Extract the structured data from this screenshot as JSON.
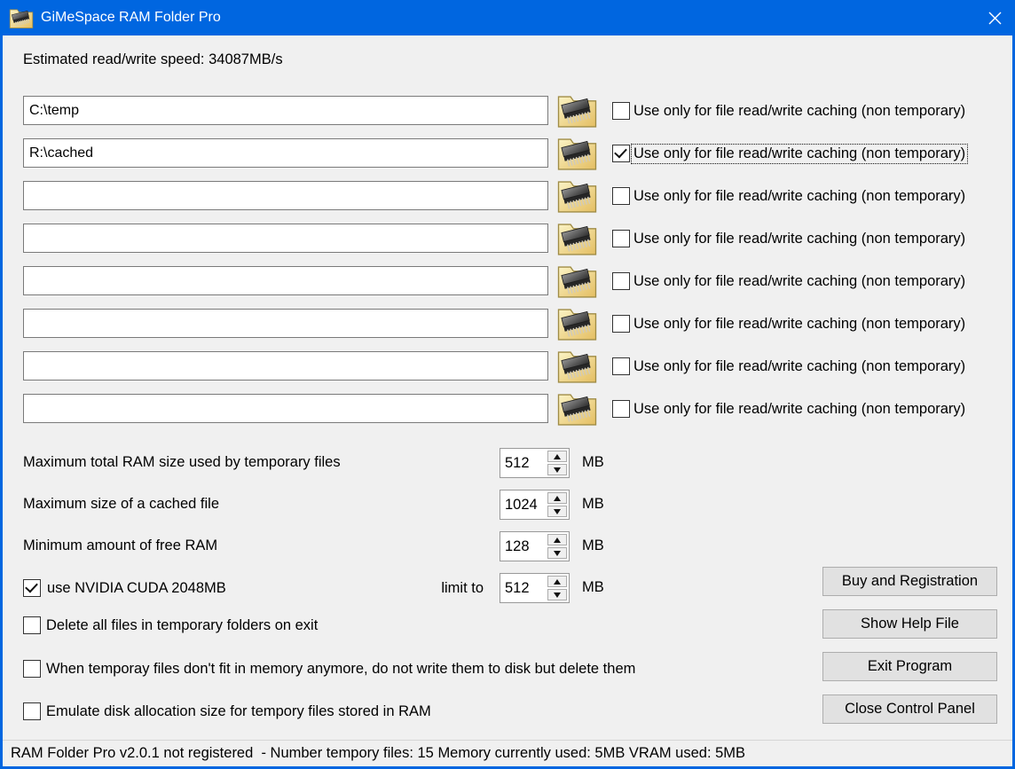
{
  "window": {
    "title": "GiMeSpace RAM Folder Pro"
  },
  "header": {
    "speed_text": "Estimated read/write speed: 34087MB/s"
  },
  "folders": {
    "rows": [
      {
        "path": "C:\\temp",
        "cache_only": false,
        "focused": false,
        "cache_label": "Use only for file read/write caching (non temporary)"
      },
      {
        "path": "R:\\cached",
        "cache_only": true,
        "focused": true,
        "cache_label": "Use only for file read/write caching (non temporary)"
      },
      {
        "path": "",
        "cache_only": false,
        "focused": false,
        "cache_label": "Use only for file read/write caching (non temporary)"
      },
      {
        "path": "",
        "cache_only": false,
        "focused": false,
        "cache_label": "Use only for file read/write caching (non temporary)"
      },
      {
        "path": "",
        "cache_only": false,
        "focused": false,
        "cache_label": "Use only for file read/write caching (non temporary)"
      },
      {
        "path": "",
        "cache_only": false,
        "focused": false,
        "cache_label": "Use only for file read/write caching (non temporary)"
      },
      {
        "path": "",
        "cache_only": false,
        "focused": false,
        "cache_label": "Use only for file read/write caching (non temporary)"
      },
      {
        "path": "",
        "cache_only": false,
        "focused": false,
        "cache_label": "Use only for file read/write caching (non temporary)"
      }
    ]
  },
  "settings": {
    "rows": [
      {
        "label": "Maximum total RAM size used by temporary files",
        "value": "512",
        "unit": "MB"
      },
      {
        "label": "Maximum size of a cached file",
        "value": "1024",
        "unit": "MB"
      },
      {
        "label": "Minimum amount of free RAM",
        "value": "128",
        "unit": "MB"
      }
    ],
    "cuda": {
      "label": "use NVIDIA CUDA 2048MB",
      "checked": true,
      "limit_label": "limit to",
      "value": "512",
      "unit": "MB"
    }
  },
  "options": [
    {
      "label": "Delete all files in temporary folders on exit",
      "checked": false
    },
    {
      "label": "When temporay files don't fit in memory anymore, do not write them to disk but delete them",
      "checked": false
    },
    {
      "label": "Emulate disk allocation size for tempory files stored in RAM",
      "checked": false
    }
  ],
  "actions": [
    {
      "label": "Buy and Registration",
      "name": "buy-and-registration-button"
    },
    {
      "label": "Show Help File",
      "name": "show-help-file-button"
    },
    {
      "label": "Exit Program",
      "name": "exit-program-button"
    },
    {
      "label": "Close Control Panel",
      "name": "close-control-panel-button"
    }
  ],
  "status_bar": {
    "text": "RAM Folder Pro v2.0.1 not registered  - Number tempory files: 15 Memory currently used: 5MB VRAM used: 5MB"
  },
  "colors": {
    "accent_blue": "#0066E0",
    "window_bg": "#F0F0F0",
    "button_bg": "#E1E1E1",
    "folder_icon_yellow": "#E6C26A"
  }
}
